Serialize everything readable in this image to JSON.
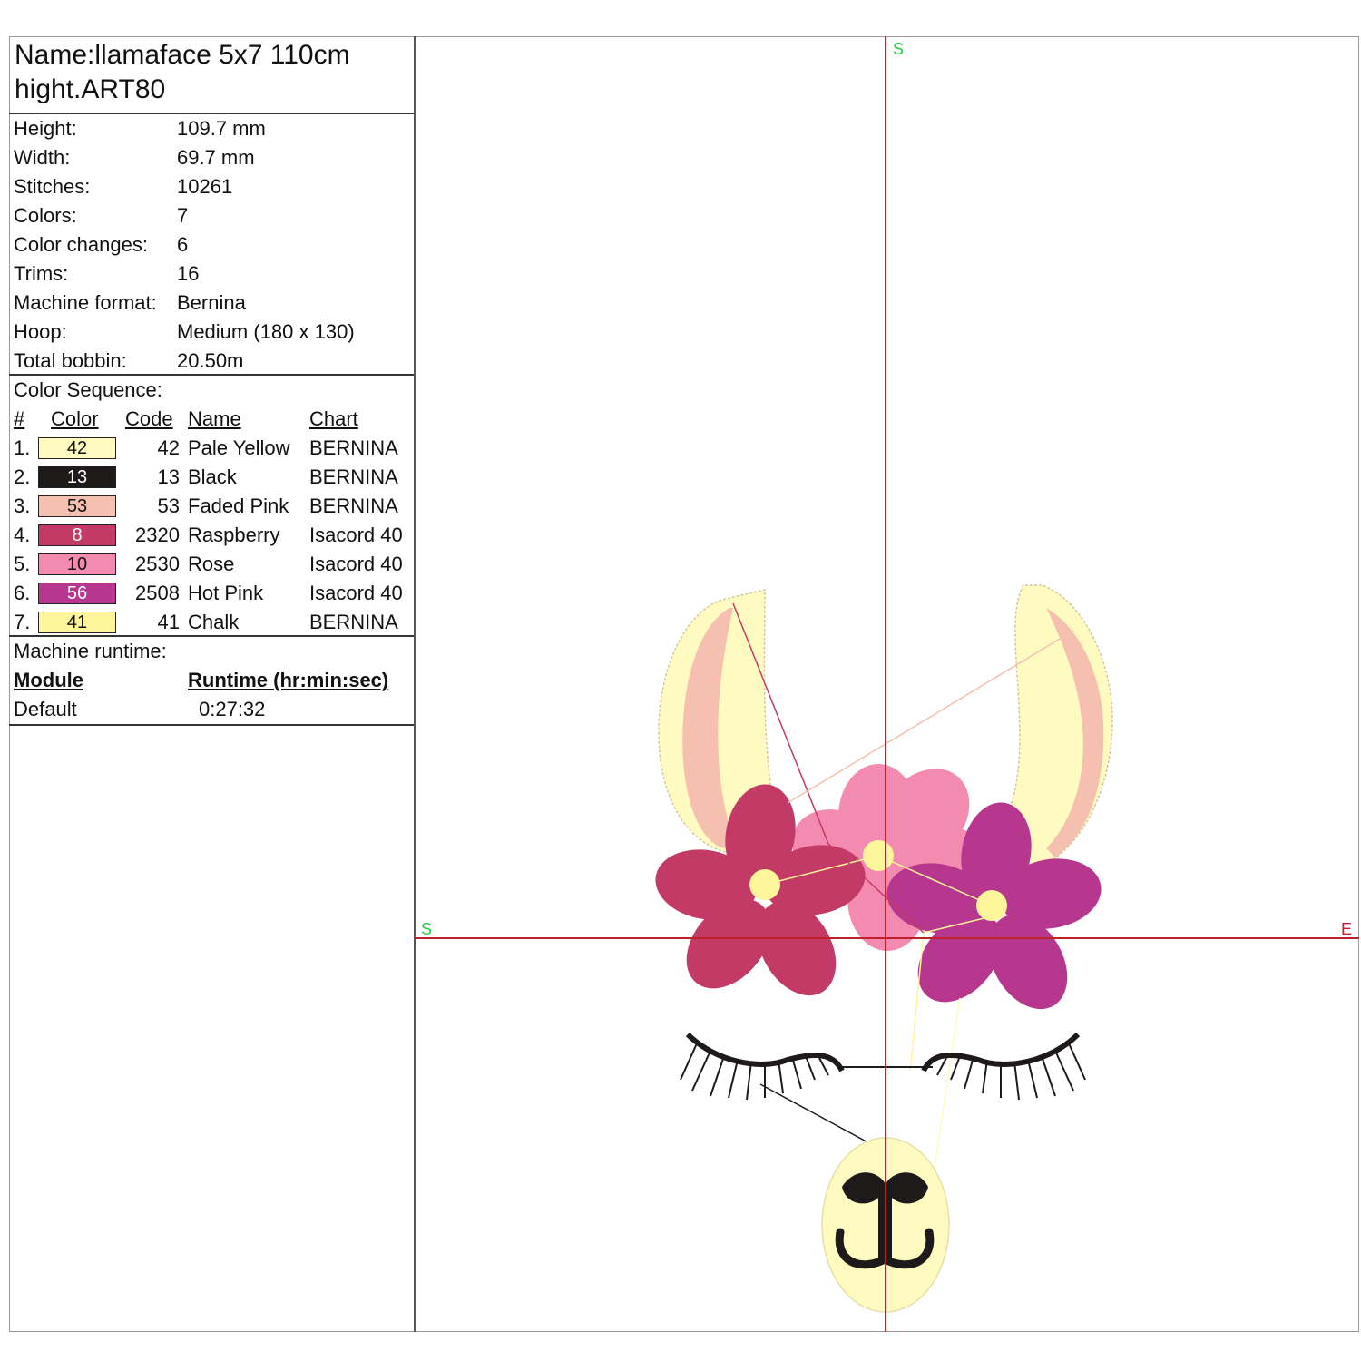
{
  "design": {
    "title_line1": "Name:llamaface 5x7 110cm",
    "title_line2": "hight.ART80"
  },
  "stats": [
    {
      "label": "Height:",
      "value": "109.7 mm"
    },
    {
      "label": "Width:",
      "value": "69.7 mm"
    },
    {
      "label": "Stitches:",
      "value": "10261"
    },
    {
      "label": "Colors:",
      "value": "7"
    },
    {
      "label": "Color changes:",
      "value": "6"
    },
    {
      "label": "Trims:",
      "value": "16"
    },
    {
      "label": "Machine format:",
      "value": "Bernina"
    },
    {
      "label": "Hoop:",
      "value": "Medium (180 x 130)"
    },
    {
      "label": "Total bobbin:",
      "value": "20.50m"
    }
  ],
  "color_sequence": {
    "title": "Color Sequence:",
    "headers": {
      "num": "#",
      "color": "Color",
      "code": "Code",
      "name": "Name",
      "chart": "Chart"
    },
    "rows": [
      {
        "num": "1.",
        "swatch_label": "42",
        "swatch_color": "#FFFBC0",
        "swatch_text_color": "#111111",
        "code": "42",
        "name": "Pale Yellow",
        "chart": "BERNINA"
      },
      {
        "num": "2.",
        "swatch_label": "13",
        "swatch_color": "#1E1A1A",
        "swatch_text_color": "#ffffff",
        "code": "13",
        "name": "Black",
        "chart": "BERNINA"
      },
      {
        "num": "3.",
        "swatch_label": "53",
        "swatch_color": "#F5C0B0",
        "swatch_text_color": "#111111",
        "code": "53",
        "name": "Faded Pink",
        "chart": "BERNINA"
      },
      {
        "num": "4.",
        "swatch_label": "8",
        "swatch_color": "#C33A66",
        "swatch_text_color": "#ffffff",
        "code": "2320",
        "name": "Raspberry",
        "chart": "Isacord 40"
      },
      {
        "num": "5.",
        "swatch_label": "10",
        "swatch_color": "#F38BB0",
        "swatch_text_color": "#111111",
        "code": "2530",
        "name": "Rose",
        "chart": "Isacord 40"
      },
      {
        "num": "6.",
        "swatch_label": "56",
        "swatch_color": "#B8378E",
        "swatch_text_color": "#ffffff",
        "code": "2508",
        "name": "Hot Pink",
        "chart": "Isacord 40"
      },
      {
        "num": "7.",
        "swatch_label": "41",
        "swatch_color": "#FFF59A",
        "swatch_text_color": "#111111",
        "code": "41",
        "name": "Chalk",
        "chart": "BERNINA"
      }
    ]
  },
  "runtime": {
    "title": "Machine runtime:",
    "module_header": "Module",
    "runtime_header": "Runtime (hr:min:sec)",
    "module": "Default",
    "value": "0:27:32"
  },
  "canvas": {
    "axis_top_label": "S",
    "axis_left_label": "S",
    "axis_right_label": "E",
    "axis_color": "#C0202A",
    "label_color": "#22CC44"
  }
}
